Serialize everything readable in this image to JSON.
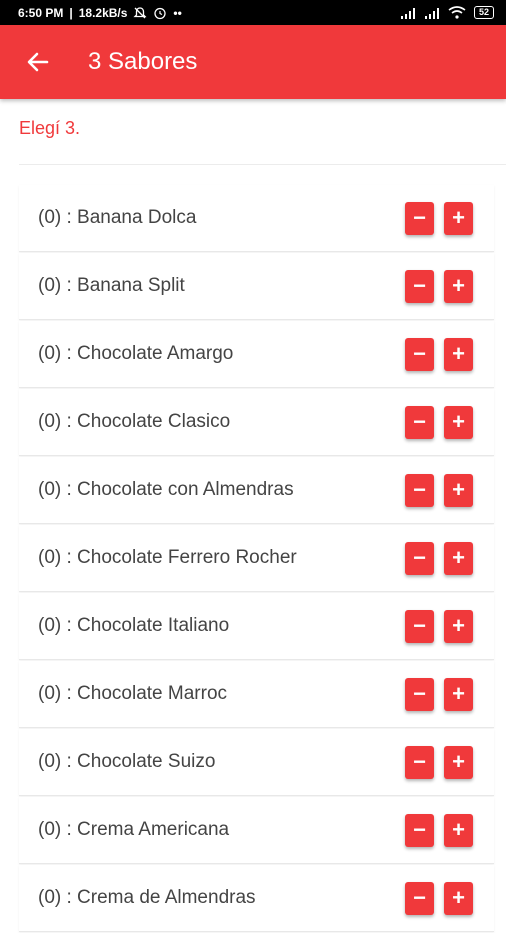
{
  "status_bar": {
    "time": "6:50 PM",
    "speed": "18.2kB/s",
    "extra_icons": "••",
    "battery": "52"
  },
  "app_bar": {
    "title": "3 Sabores",
    "back_icon": "arrow-left-icon"
  },
  "instruction": "Elegí 3.",
  "buttons": {
    "minus": "−",
    "plus": "+"
  },
  "flavors": [
    {
      "label": "(0) : Banana Dolca"
    },
    {
      "label": "(0) : Banana Split"
    },
    {
      "label": "(0) : Chocolate Amargo"
    },
    {
      "label": "(0) : Chocolate Clasico"
    },
    {
      "label": "(0) : Chocolate con Almendras"
    },
    {
      "label": "(0) : Chocolate Ferrero Rocher"
    },
    {
      "label": "(0) : Chocolate Italiano"
    },
    {
      "label": "(0) : Chocolate Marroc"
    },
    {
      "label": "(0) : Chocolate Suizo"
    },
    {
      "label": "(0) : Crema Americana"
    },
    {
      "label": "(0) : Crema de Almendras"
    }
  ],
  "colors": {
    "accent": "#f0393b",
    "text": "#444444"
  }
}
